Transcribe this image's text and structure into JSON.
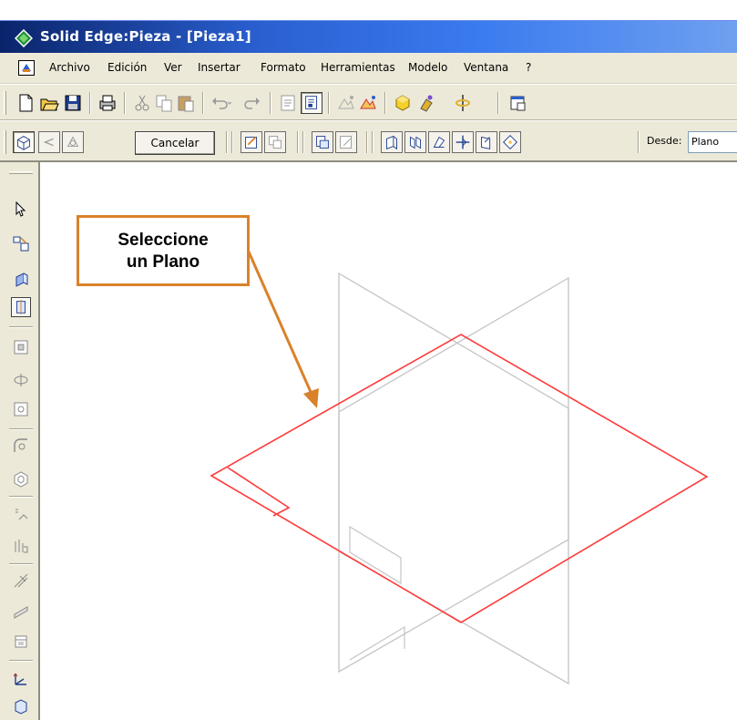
{
  "window": {
    "title": "Solid Edge:Pieza - [Pieza1]",
    "app_icon": "solid-edge-logo-icon",
    "title_bar_color": "#2a5fd0"
  },
  "menubar": {
    "doc_icon": "document-icon",
    "items": [
      "Archivo",
      "Edición",
      "Ver",
      "Insertar",
      "Formato",
      "Herramientas",
      "Modelo",
      "Ventana",
      "?"
    ]
  },
  "toolbar_standard": {
    "icons": [
      "new-file-icon",
      "open-folder-icon",
      "save-icon",
      "print-icon",
      "cut-icon",
      "copy-icon",
      "paste-icon",
      "undo-icon",
      "redo-icon",
      "properties-icon",
      "sketch-view-icon",
      "zoom-icon",
      "fit-icon",
      "part-color-icon",
      "paint-icon",
      "rotate-icon",
      "window-icon"
    ]
  },
  "ribbon": {
    "cancel_label": "Cancelar",
    "desde_label": "Desde:",
    "desde_value": "Plano",
    "icons": [
      "plane-step-icon",
      "back-step-icon",
      "extent-step-icon",
      "sketch-draw-icon",
      "select-sketch-icon",
      "profile-icon",
      "edit-profile-icon",
      "coincident-plane-icon",
      "parallel-plane-icon",
      "angled-plane-icon",
      "perpendicular-plane-icon",
      "tangent-plane-icon",
      "three-points-plane-icon"
    ]
  },
  "leftbar": {
    "icons": [
      "select-arrow-icon",
      "sketch-icon",
      "protrusion-icon",
      "revolved-protrusion-icon",
      "cutout-icon",
      "revolved-cutout-icon",
      "hole-icon",
      "round-icon",
      "shell-icon",
      "draft-icon",
      "rib-icon",
      "web-network-icon",
      "thin-region-icon",
      "lip-icon",
      "coordinate-system-icon",
      "part-library-icon"
    ]
  },
  "callout": {
    "line1": "Seleccione",
    "line2": "un Plano",
    "border_color": "#d9822b"
  },
  "colors": {
    "highlighted_plane": "#ff3b3b",
    "reference_planes": "#c4c4c4",
    "arrow": "#d9822b"
  }
}
